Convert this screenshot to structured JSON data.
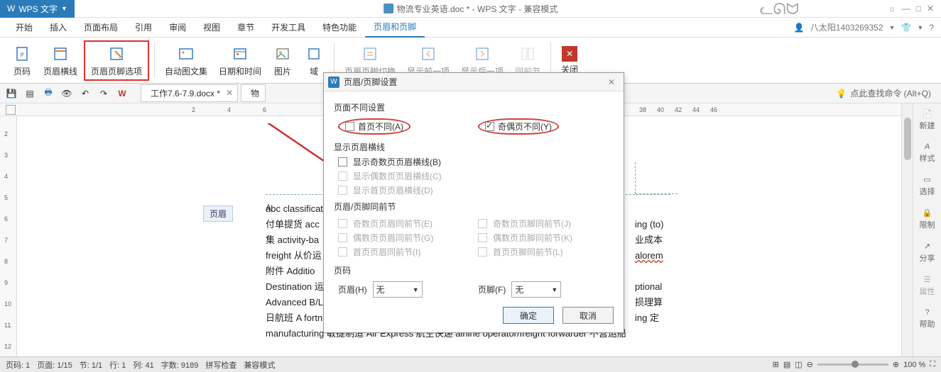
{
  "app": {
    "brand": "WPS 文字"
  },
  "title": {
    "doc": "物流专业英语.doc * - WPS 文字 - 兼容模式"
  },
  "user": {
    "name": "八太阳1403269352"
  },
  "menubar": [
    "开始",
    "插入",
    "页面布局",
    "引用",
    "审阅",
    "视图",
    "章节",
    "开发工具",
    "特色功能",
    "页眉和页脚"
  ],
  "ribbon": {
    "page_number": "页码",
    "header_line": "页眉横线",
    "header_footer_options": "页眉页脚选项",
    "auto_album": "自动图文集",
    "date_time": "日期和时间",
    "picture": "图片",
    "field": "域",
    "switch": "页眉页脚切换",
    "prev": "显示前一项",
    "next": "显示后一项",
    "same_prev": "同前节",
    "close": "关闭"
  },
  "quick": {
    "tab1": "工作7.6-7.9.docx *",
    "tab2": "物",
    "search_cmd": "点此查找命令 (Alt+Q)"
  },
  "ruler": {
    "marks_left": [
      "2",
      "4",
      "6"
    ],
    "marks_right": [
      "38",
      "40",
      "42",
      "44",
      "46"
    ]
  },
  "vruler": [
    "2",
    "3",
    "4",
    "5",
    "6",
    "7",
    "8",
    "9",
    "10",
    "11",
    "12"
  ],
  "doc": {
    "header_label": "页眉",
    "header_a": "A",
    "lines": [
      "abc classificati",
      "付单提货  acc",
      "集  activity-ba",
      "freight 从价运",
      "附件 Additio",
      "Destination 运",
      "Advanced B/L",
      "日航班   A fortnight sailing  双周班   A Friday （Tuesday / Thursday） sailing  周五班   agile",
      "manufacturing  敏捷制造  Air Express  航空快递  airline operator/freight forwarder 不营运船"
    ],
    "rhs_words": [
      "ing (to)",
      "业成本",
      "alorem",
      "ptional",
      "损理算",
      "ing  定"
    ]
  },
  "dialog": {
    "title": "页眉/页脚设置",
    "group_page_diff": "页面不同设置",
    "first_diff": "首页不同(A)",
    "odd_even_diff": "奇偶页不同(Y)",
    "group_show_line": "显示页眉横线",
    "show_odd_line": "显示奇数页页眉横线(B)",
    "show_even_line": "显示偶数页页眉横线(C)",
    "show_first_line": "显示首页页眉横线(D)",
    "group_same_prev": "页眉/页脚同前节",
    "odd_header_same": "奇数页页眉同前节(E)",
    "odd_footer_same": "奇数页页脚同前节(J)",
    "even_header_same": "偶数页页眉同前节(G)",
    "even_footer_same": "偶数页页脚同前节(K)",
    "first_header_same": "首页页眉同前节(I)",
    "first_footer_same": "首页页脚同前节(L)",
    "group_page_num": "页码",
    "header_label": "页眉(H)",
    "footer_label": "页脚(F)",
    "none": "无",
    "ok": "确定",
    "cancel": "取消"
  },
  "status": {
    "page": "页码: 1",
    "pages": "页面: 1/15",
    "section": "节: 1/1",
    "row": "行: 1",
    "col": "列: 41",
    "words": "字数: 9189",
    "spell": "拼写检查",
    "compat": "兼容模式",
    "zoom": "100 %"
  },
  "side": {
    "new": "新建",
    "style": "样式",
    "select": "选择",
    "limit": "限制",
    "share": "分享",
    "attr": "属性",
    "help": "帮助"
  }
}
